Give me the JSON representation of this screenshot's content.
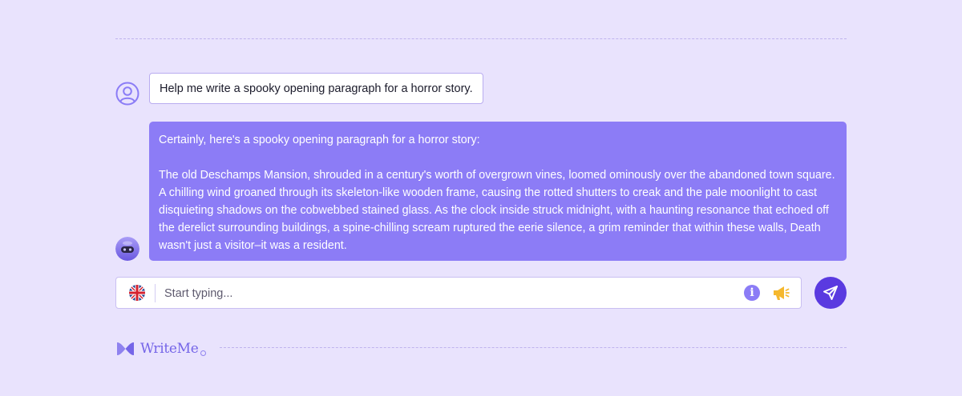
{
  "conversation": {
    "user_message": "Help me write a spooky opening paragraph for a horror story.",
    "bot_intro": "Certainly, here's a spooky opening paragraph for a horror story:",
    "bot_story": "The old Deschamps Mansion, shrouded in a century's worth of overgrown vines, loomed ominously over the abandoned town square. A chilling wind groaned through its skeleton-like wooden frame, causing the rotted shutters to creak and the pale moonlight to cast disquieting shadows on the cobwebbed stained glass. As the clock inside struck midnight, with a haunting resonance that echoed off the derelict surrounding buildings, a spine-chilling scream ruptured the eerie silence, a grim reminder that within these walls, Death wasn't just a visitor–it was a resident."
  },
  "composer": {
    "placeholder": "Start typing...",
    "value": "",
    "language_icon": "uk-flag-icon",
    "info_icon": "info-icon",
    "info_glyph": "i",
    "announce_icon": "megaphone-icon",
    "send_icon": "send-icon"
  },
  "brand": {
    "name": "WriteMe",
    "logo_icon": "writeme-logo-icon"
  },
  "colors": {
    "background": "#e9e3fd",
    "bot_bubble": "#8c7cf6",
    "accent": "#5a3ae0",
    "megaphone": "#f5b82e"
  }
}
